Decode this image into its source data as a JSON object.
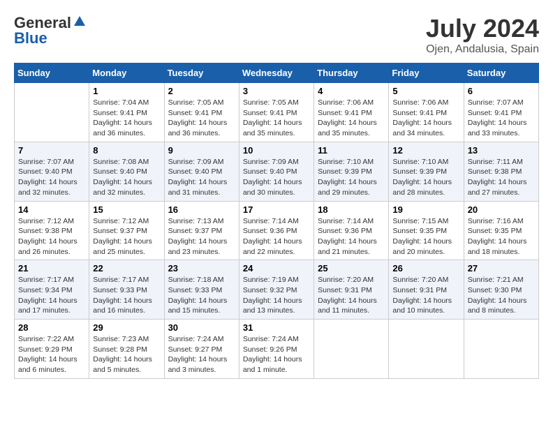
{
  "header": {
    "logo_general": "General",
    "logo_blue": "Blue",
    "month_year": "July 2024",
    "location": "Ojen, Andalusia, Spain"
  },
  "days_of_week": [
    "Sunday",
    "Monday",
    "Tuesday",
    "Wednesday",
    "Thursday",
    "Friday",
    "Saturday"
  ],
  "weeks": [
    [
      {
        "day": "",
        "content": ""
      },
      {
        "day": "1",
        "content": "Sunrise: 7:04 AM\nSunset: 9:41 PM\nDaylight: 14 hours\nand 36 minutes."
      },
      {
        "day": "2",
        "content": "Sunrise: 7:05 AM\nSunset: 9:41 PM\nDaylight: 14 hours\nand 36 minutes."
      },
      {
        "day": "3",
        "content": "Sunrise: 7:05 AM\nSunset: 9:41 PM\nDaylight: 14 hours\nand 35 minutes."
      },
      {
        "day": "4",
        "content": "Sunrise: 7:06 AM\nSunset: 9:41 PM\nDaylight: 14 hours\nand 35 minutes."
      },
      {
        "day": "5",
        "content": "Sunrise: 7:06 AM\nSunset: 9:41 PM\nDaylight: 14 hours\nand 34 minutes."
      },
      {
        "day": "6",
        "content": "Sunrise: 7:07 AM\nSunset: 9:41 PM\nDaylight: 14 hours\nand 33 minutes."
      }
    ],
    [
      {
        "day": "7",
        "content": "Sunrise: 7:07 AM\nSunset: 9:40 PM\nDaylight: 14 hours\nand 32 minutes."
      },
      {
        "day": "8",
        "content": "Sunrise: 7:08 AM\nSunset: 9:40 PM\nDaylight: 14 hours\nand 32 minutes."
      },
      {
        "day": "9",
        "content": "Sunrise: 7:09 AM\nSunset: 9:40 PM\nDaylight: 14 hours\nand 31 minutes."
      },
      {
        "day": "10",
        "content": "Sunrise: 7:09 AM\nSunset: 9:40 PM\nDaylight: 14 hours\nand 30 minutes."
      },
      {
        "day": "11",
        "content": "Sunrise: 7:10 AM\nSunset: 9:39 PM\nDaylight: 14 hours\nand 29 minutes."
      },
      {
        "day": "12",
        "content": "Sunrise: 7:10 AM\nSunset: 9:39 PM\nDaylight: 14 hours\nand 28 minutes."
      },
      {
        "day": "13",
        "content": "Sunrise: 7:11 AM\nSunset: 9:38 PM\nDaylight: 14 hours\nand 27 minutes."
      }
    ],
    [
      {
        "day": "14",
        "content": "Sunrise: 7:12 AM\nSunset: 9:38 PM\nDaylight: 14 hours\nand 26 minutes."
      },
      {
        "day": "15",
        "content": "Sunrise: 7:12 AM\nSunset: 9:37 PM\nDaylight: 14 hours\nand 25 minutes."
      },
      {
        "day": "16",
        "content": "Sunrise: 7:13 AM\nSunset: 9:37 PM\nDaylight: 14 hours\nand 23 minutes."
      },
      {
        "day": "17",
        "content": "Sunrise: 7:14 AM\nSunset: 9:36 PM\nDaylight: 14 hours\nand 22 minutes."
      },
      {
        "day": "18",
        "content": "Sunrise: 7:14 AM\nSunset: 9:36 PM\nDaylight: 14 hours\nand 21 minutes."
      },
      {
        "day": "19",
        "content": "Sunrise: 7:15 AM\nSunset: 9:35 PM\nDaylight: 14 hours\nand 20 minutes."
      },
      {
        "day": "20",
        "content": "Sunrise: 7:16 AM\nSunset: 9:35 PM\nDaylight: 14 hours\nand 18 minutes."
      }
    ],
    [
      {
        "day": "21",
        "content": "Sunrise: 7:17 AM\nSunset: 9:34 PM\nDaylight: 14 hours\nand 17 minutes."
      },
      {
        "day": "22",
        "content": "Sunrise: 7:17 AM\nSunset: 9:33 PM\nDaylight: 14 hours\nand 16 minutes."
      },
      {
        "day": "23",
        "content": "Sunrise: 7:18 AM\nSunset: 9:33 PM\nDaylight: 14 hours\nand 15 minutes."
      },
      {
        "day": "24",
        "content": "Sunrise: 7:19 AM\nSunset: 9:32 PM\nDaylight: 14 hours\nand 13 minutes."
      },
      {
        "day": "25",
        "content": "Sunrise: 7:20 AM\nSunset: 9:31 PM\nDaylight: 14 hours\nand 11 minutes."
      },
      {
        "day": "26",
        "content": "Sunrise: 7:20 AM\nSunset: 9:31 PM\nDaylight: 14 hours\nand 10 minutes."
      },
      {
        "day": "27",
        "content": "Sunrise: 7:21 AM\nSunset: 9:30 PM\nDaylight: 14 hours\nand 8 minutes."
      }
    ],
    [
      {
        "day": "28",
        "content": "Sunrise: 7:22 AM\nSunset: 9:29 PM\nDaylight: 14 hours\nand 6 minutes."
      },
      {
        "day": "29",
        "content": "Sunrise: 7:23 AM\nSunset: 9:28 PM\nDaylight: 14 hours\nand 5 minutes."
      },
      {
        "day": "30",
        "content": "Sunrise: 7:24 AM\nSunset: 9:27 PM\nDaylight: 14 hours\nand 3 minutes."
      },
      {
        "day": "31",
        "content": "Sunrise: 7:24 AM\nSunset: 9:26 PM\nDaylight: 14 hours\nand 1 minute."
      },
      {
        "day": "",
        "content": ""
      },
      {
        "day": "",
        "content": ""
      },
      {
        "day": "",
        "content": ""
      }
    ]
  ]
}
